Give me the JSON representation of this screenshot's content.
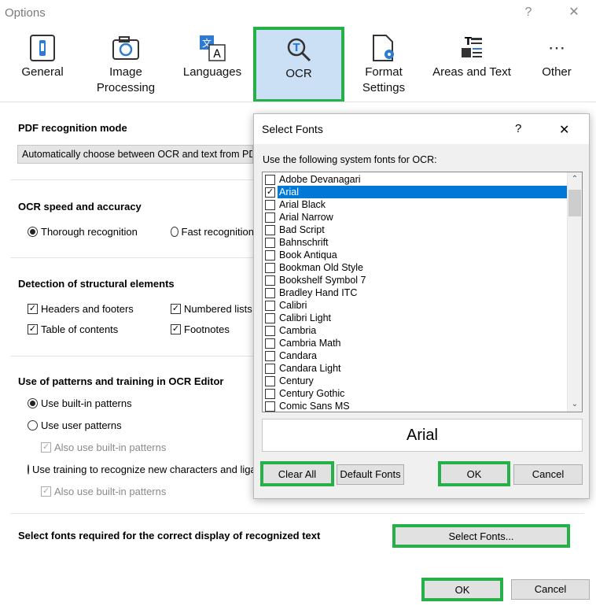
{
  "window": {
    "title": "Options",
    "help": "?",
    "close": "✕"
  },
  "toolbar": [
    {
      "label": "General"
    },
    {
      "label": "Image\nProcessing"
    },
    {
      "label": "Languages"
    },
    {
      "label": "OCR"
    },
    {
      "label": "Format\nSettings"
    },
    {
      "label": "Areas and Text"
    },
    {
      "label": "Other"
    }
  ],
  "pdf": {
    "heading": "PDF recognition mode",
    "combo_value": "Automatically choose between OCR and text from PDF"
  },
  "speed": {
    "heading": "OCR speed and accuracy",
    "thorough": "Thorough recognition",
    "fast": "Fast recognition"
  },
  "structural": {
    "heading": "Detection of structural elements",
    "headers": "Headers and footers",
    "numbered": "Numbered lists",
    "toc": "Table of contents",
    "footnotes": "Footnotes"
  },
  "patterns": {
    "heading": "Use of patterns and training in OCR Editor",
    "builtin": "Use built-in patterns",
    "user": "Use user patterns",
    "also1": "Also use built-in patterns",
    "training": "Use training to recognize new characters and ligatures",
    "also2": "Also use built-in patterns"
  },
  "fonts_section": {
    "heading": "Select fonts required for the correct display of recognized text",
    "button": "Select Fonts..."
  },
  "footer": {
    "ok": "OK",
    "cancel": "Cancel"
  },
  "dialog": {
    "title": "Select Fonts",
    "help": "?",
    "close": "✕",
    "instruction": "Use the following system fonts for OCR:",
    "fonts": [
      {
        "name": "Adobe Devanagari",
        "checked": false
      },
      {
        "name": "Arial",
        "checked": true
      },
      {
        "name": "Arial Black",
        "checked": false
      },
      {
        "name": "Arial Narrow",
        "checked": false
      },
      {
        "name": "Bad Script",
        "checked": false
      },
      {
        "name": "Bahnschrift",
        "checked": false
      },
      {
        "name": "Book Antiqua",
        "checked": false
      },
      {
        "name": "Bookman Old Style",
        "checked": false
      },
      {
        "name": "Bookshelf Symbol 7",
        "checked": false
      },
      {
        "name": "Bradley Hand ITC",
        "checked": false
      },
      {
        "name": "Calibri",
        "checked": false
      },
      {
        "name": "Calibri Light",
        "checked": false
      },
      {
        "name": "Cambria",
        "checked": false
      },
      {
        "name": "Cambria Math",
        "checked": false
      },
      {
        "name": "Candara",
        "checked": false
      },
      {
        "name": "Candara Light",
        "checked": false
      },
      {
        "name": "Century",
        "checked": false
      },
      {
        "name": "Century Gothic",
        "checked": false
      },
      {
        "name": "Comic Sans MS",
        "checked": false
      }
    ],
    "preview": "Arial",
    "clear_all": "Clear All",
    "default_fonts": "Default Fonts",
    "ok": "OK",
    "cancel": "Cancel"
  },
  "colors": {
    "highlight": "#26b04a",
    "selection": "#0078d7",
    "ocr_tab_bg": "#cce0f5"
  }
}
